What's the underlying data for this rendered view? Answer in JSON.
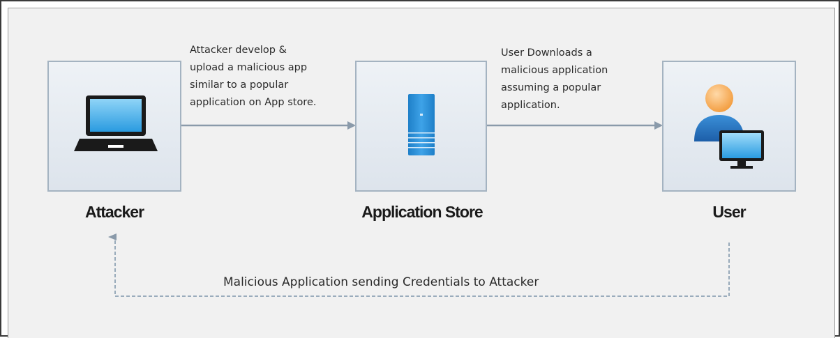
{
  "nodes": {
    "attacker": {
      "label": "Attacker",
      "icon": "laptop-icon"
    },
    "store": {
      "label": "Application Store",
      "icon": "server-icon"
    },
    "user": {
      "label": "User",
      "icon": "user-computer-icon"
    }
  },
  "edges": {
    "attacker_to_store": {
      "lines": [
        "Attacker develop &",
        "upload a malicious app",
        "similar to a popular",
        "application on App store."
      ]
    },
    "store_to_user": {
      "lines": [
        "User Downloads a",
        "malicious application",
        "assuming a popular",
        "application."
      ]
    },
    "user_to_attacker": {
      "label": "Malicious Application sending Credentials to Attacker"
    }
  },
  "colors": {
    "arrow": "#8a9aaa",
    "box_border": "#a4b3c1",
    "icon_blue": "#2f8fd6",
    "dashed": "#8ea2b4"
  }
}
